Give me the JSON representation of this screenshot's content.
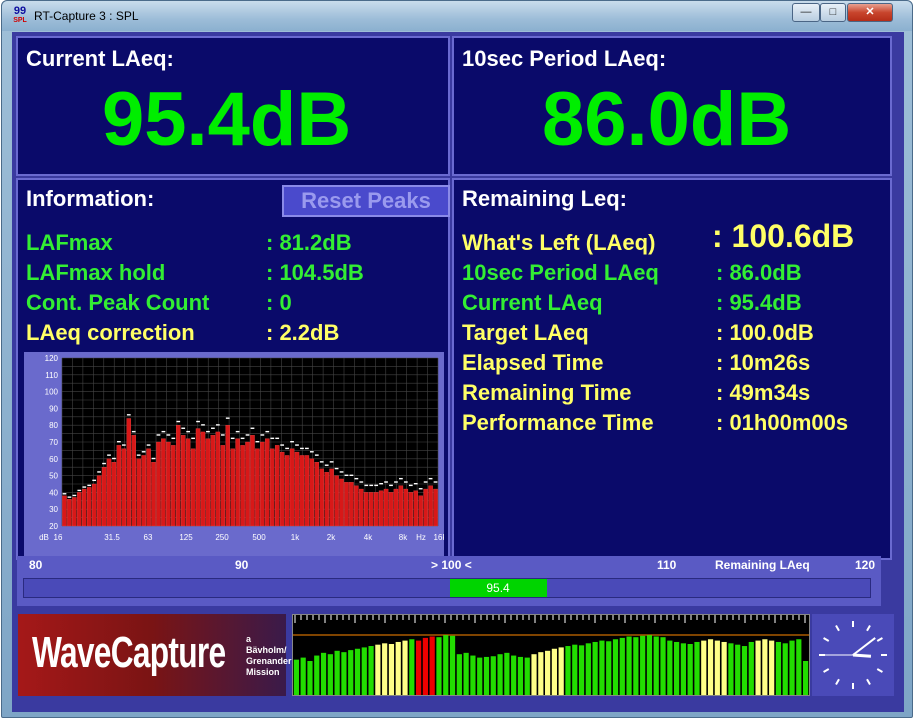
{
  "window": {
    "title": "RT-Capture 3 : SPL",
    "icon_top": "99",
    "icon_bottom": "SPL",
    "controls": [
      "minimize",
      "maximize",
      "close"
    ]
  },
  "current_laeq": {
    "label": "Current LAeq:",
    "value": "95.4dB"
  },
  "period_laeq": {
    "label": "10sec Period LAeq:",
    "value": "86.0dB"
  },
  "information": {
    "title": "Information:",
    "reset_label": "Reset Peaks",
    "rows": [
      {
        "label": "LAFmax",
        "value": ": 81.2dB",
        "color": "green"
      },
      {
        "label": "LAFmax hold",
        "value": ": 104.5dB",
        "color": "green"
      },
      {
        "label": "Cont. Peak Count",
        "value": ": 0",
        "color": "green"
      },
      {
        "label": "LAeq correction",
        "value": ": 2.2dB",
        "color": "yellow"
      }
    ]
  },
  "remaining": {
    "title": "Remaining Leq:",
    "whats_left_label": "What's Left (LAeq)",
    "whats_left_value": ": 100.6dB",
    "rows": [
      {
        "label": "10sec Period LAeq",
        "value": ": 86.0dB",
        "color": "green"
      },
      {
        "label": "Current LAeq",
        "value": ": 95.4dB",
        "color": "green"
      },
      {
        "label": "Target LAeq",
        "value": ": 100.0dB",
        "color": "yellow"
      },
      {
        "label": "Elapsed Time",
        "value": ": 10m26s",
        "color": "yellow"
      },
      {
        "label": "Remaining Time",
        "value": ": 49m34s",
        "color": "yellow"
      },
      {
        "label": "Performance Time",
        "value": ": 01h00m00s",
        "color": "yellow"
      }
    ]
  },
  "chart_data": {
    "type": "bar",
    "y_ticks": [
      "120",
      "110",
      "100",
      "90",
      "80",
      "70",
      "60",
      "50",
      "40",
      "30",
      "20"
    ],
    "ylim": [
      20,
      120
    ],
    "x_tick_labels": [
      "dB",
      "16",
      "31.5",
      "63",
      "125",
      "250",
      "500",
      "1k",
      "2k",
      "4k",
      "8k",
      "Hz",
      "16k"
    ],
    "values": [
      38,
      36,
      37,
      40,
      42,
      43,
      45,
      50,
      55,
      60,
      58,
      68,
      66,
      84,
      74,
      60,
      62,
      66,
      58,
      70,
      72,
      70,
      68,
      80,
      74,
      72,
      66,
      78,
      76,
      72,
      74,
      76,
      68,
      80,
      66,
      72,
      68,
      70,
      74,
      66,
      70,
      72,
      66,
      68,
      64,
      62,
      66,
      64,
      62,
      62,
      60,
      58,
      54,
      52,
      54,
      50,
      48,
      46,
      46,
      44,
      42,
      40,
      40,
      40,
      41,
      42,
      40,
      42,
      44,
      42,
      40,
      41,
      38,
      42,
      44,
      42
    ],
    "peaks": [
      39,
      37,
      38,
      41,
      43,
      44,
      47,
      52,
      57,
      62,
      60,
      70,
      68,
      86,
      76,
      62,
      64,
      68,
      60,
      74,
      76,
      74,
      72,
      82,
      78,
      76,
      72,
      82,
      80,
      76,
      78,
      80,
      74,
      84,
      72,
      76,
      72,
      74,
      78,
      70,
      74,
      76,
      72,
      72,
      68,
      66,
      70,
      68,
      66,
      66,
      64,
      62,
      58,
      56,
      58,
      54,
      52,
      50,
      50,
      48,
      46,
      44,
      44,
      44,
      45,
      46,
      44,
      46,
      48,
      46,
      44,
      45,
      42,
      46,
      48,
      46
    ]
  },
  "meter": {
    "scale_labels": [
      "80",
      "90",
      "> 100 <",
      "110",
      "Remaining LAeq",
      "120"
    ],
    "value": 95.4,
    "value_label": "95.4",
    "range": [
      80,
      120
    ]
  },
  "logo": {
    "name": "WaveCapture",
    "sub": [
      "a",
      "Bävholm/",
      "Grenander",
      "Mission"
    ]
  },
  "vu_meter": {
    "levels": [
      0.52,
      0.55,
      0.5,
      0.58,
      0.62,
      0.6,
      0.65,
      0.63,
      0.66,
      0.68,
      0.7,
      0.72,
      0.74,
      0.76,
      0.75,
      0.78,
      0.8,
      0.82,
      0.8,
      0.84,
      0.86,
      0.85,
      0.88,
      0.87,
      0.6,
      0.62,
      0.58,
      0.55,
      0.56,
      0.57,
      0.6,
      0.62,
      0.58,
      0.56,
      0.55,
      0.6,
      0.63,
      0.65,
      0.68,
      0.7,
      0.72,
      0.74,
      0.73,
      0.76,
      0.78,
      0.8,
      0.79,
      0.82,
      0.84,
      0.86,
      0.85,
      0.87,
      0.88,
      0.86,
      0.85,
      0.8,
      0.78,
      0.76,
      0.75,
      0.78,
      0.8,
      0.82,
      0.8,
      0.78,
      0.76,
      0.74,
      0.72,
      0.78,
      0.8,
      0.82,
      0.8,
      0.78,
      0.76,
      0.8,
      0.82,
      0.5
    ],
    "colors": [
      "#22dd00",
      "#ffff88",
      "#ee0000"
    ]
  },
  "clock": {
    "hour": 3,
    "minute": 8,
    "second": 45
  }
}
